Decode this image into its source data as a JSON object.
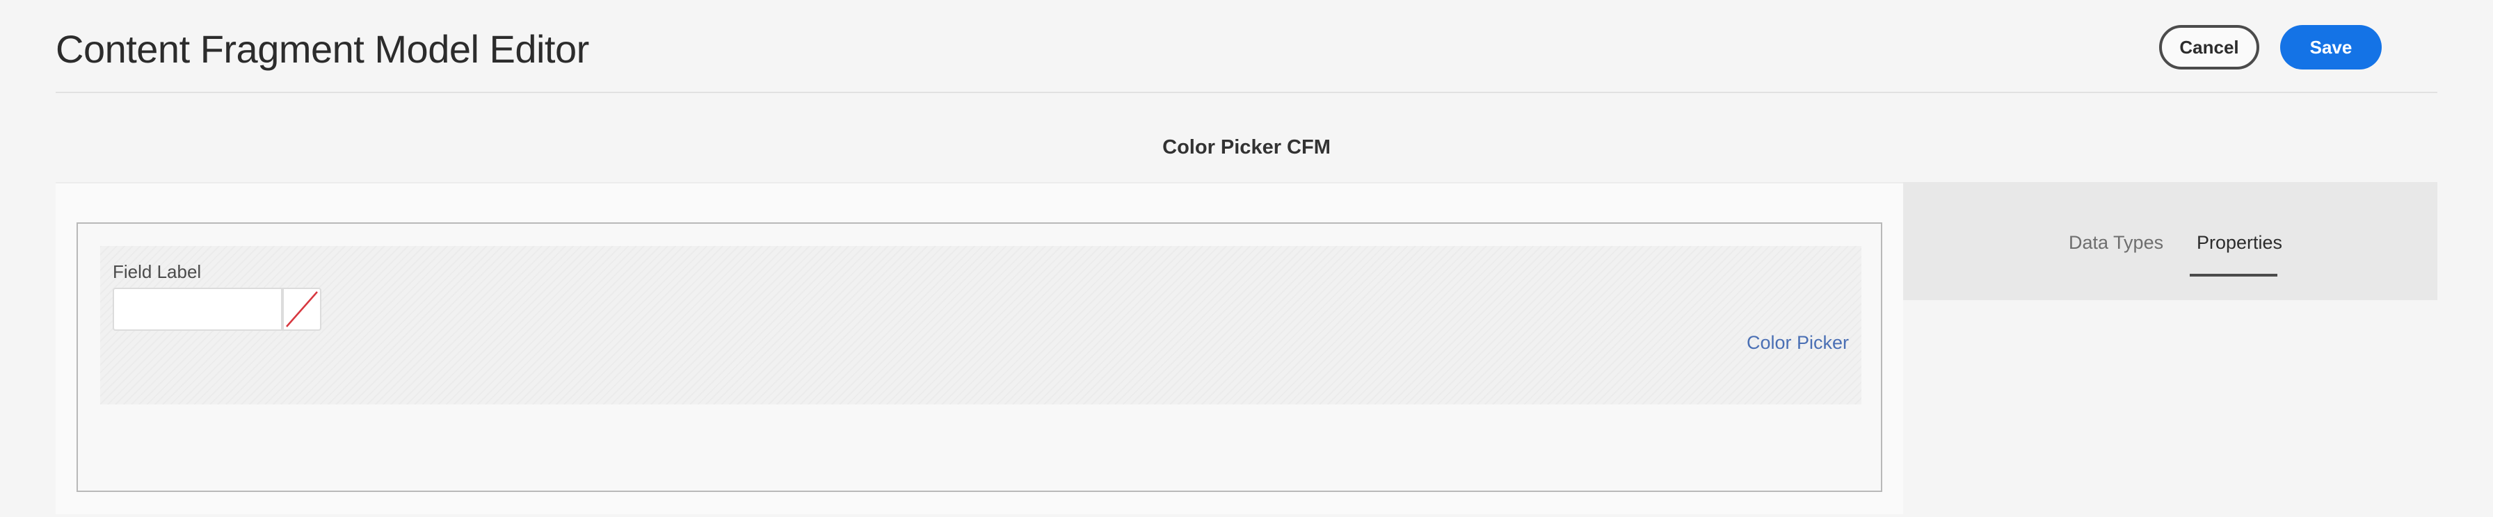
{
  "header": {
    "title": "Content Fragment Model Editor",
    "cancel_label": "Cancel",
    "save_label": "Save"
  },
  "model": {
    "title": "Color Picker CFM"
  },
  "canvas": {
    "fields": [
      {
        "label": "Field Label",
        "value": "",
        "type_label": "Color Picker",
        "swatch_state": "none"
      }
    ]
  },
  "sidebar": {
    "tabs": [
      {
        "label": "Data Types",
        "active": false
      },
      {
        "label": "Properties",
        "active": true
      }
    ]
  },
  "colors": {
    "accent": "#1473e6",
    "field_type_link": "#4a6fb4",
    "swatch_none_line": "#d7373f"
  }
}
